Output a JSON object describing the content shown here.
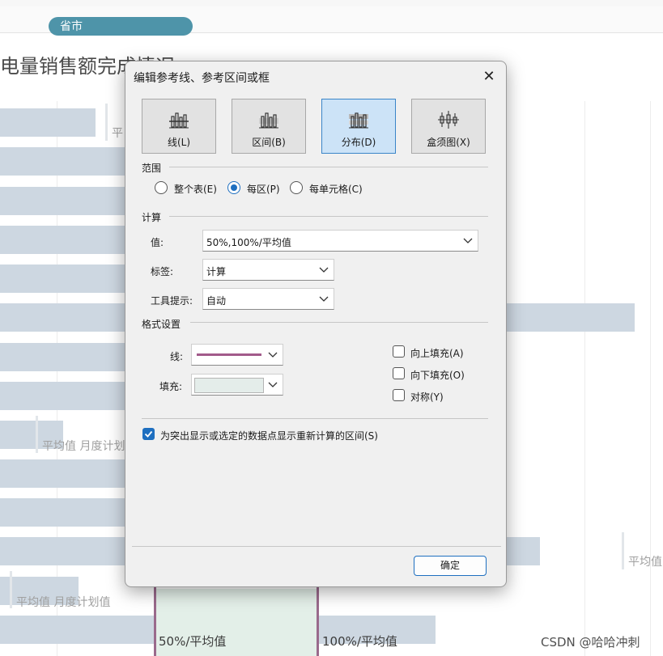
{
  "background": {
    "shelf_pill": "省市",
    "sheet_title": "电量销售额完成情况",
    "labels": {
      "avg_plan_a": "平均值 月度计划值",
      "avg_plan_b": "平均值 月度计划值",
      "avg_partial_top": "平",
      "avg_partial_right": "平均值"
    },
    "dist_labels": [
      "50%/平均值",
      "100%/平均值"
    ],
    "watermark": "CSDN @哈哈冲刺"
  },
  "dialog": {
    "title": "编辑参考线、参考区间或框",
    "close_icon": "close-icon",
    "tabs": [
      {
        "label": "线(L)",
        "icon": "reference-line-icon",
        "active": false
      },
      {
        "label": "区间(B)",
        "icon": "reference-band-icon",
        "active": false
      },
      {
        "label": "分布(D)",
        "icon": "distribution-icon",
        "active": true
      },
      {
        "label": "盒须图(X)",
        "icon": "box-plot-icon",
        "active": false
      }
    ],
    "scope": {
      "heading": "范围",
      "options": [
        {
          "label": "整个表(E)",
          "selected": false
        },
        {
          "label": "每区(P)",
          "selected": true
        },
        {
          "label": "每单元格(C)",
          "selected": false
        }
      ]
    },
    "computation": {
      "heading": "计算",
      "value_label": "值:",
      "value": "50%,100%/平均值",
      "label_label": "标签:",
      "label_value": "计算",
      "tooltip_label": "工具提示:",
      "tooltip_value": "自动"
    },
    "formatting": {
      "heading": "格式设置",
      "line_label": "线:",
      "line_color": "#a25a8a",
      "fill_label": "填充:",
      "fill_color": "#e4edea",
      "fill_above": {
        "label": "向上填充(A)",
        "checked": false
      },
      "fill_below": {
        "label": "向下填充(O)",
        "checked": false
      },
      "symmetric": {
        "label": "对称(Y)",
        "checked": false
      }
    },
    "recalc": {
      "label": "为突出显示或选定的数据点显示重新计算的区间(S)",
      "checked": true
    },
    "ok_label": "确定"
  },
  "colors": {
    "accent": "#1e6fc0",
    "pill": "#4e94a9",
    "bar": "#cdd7e1",
    "reference_line": "#9a6a8c"
  }
}
